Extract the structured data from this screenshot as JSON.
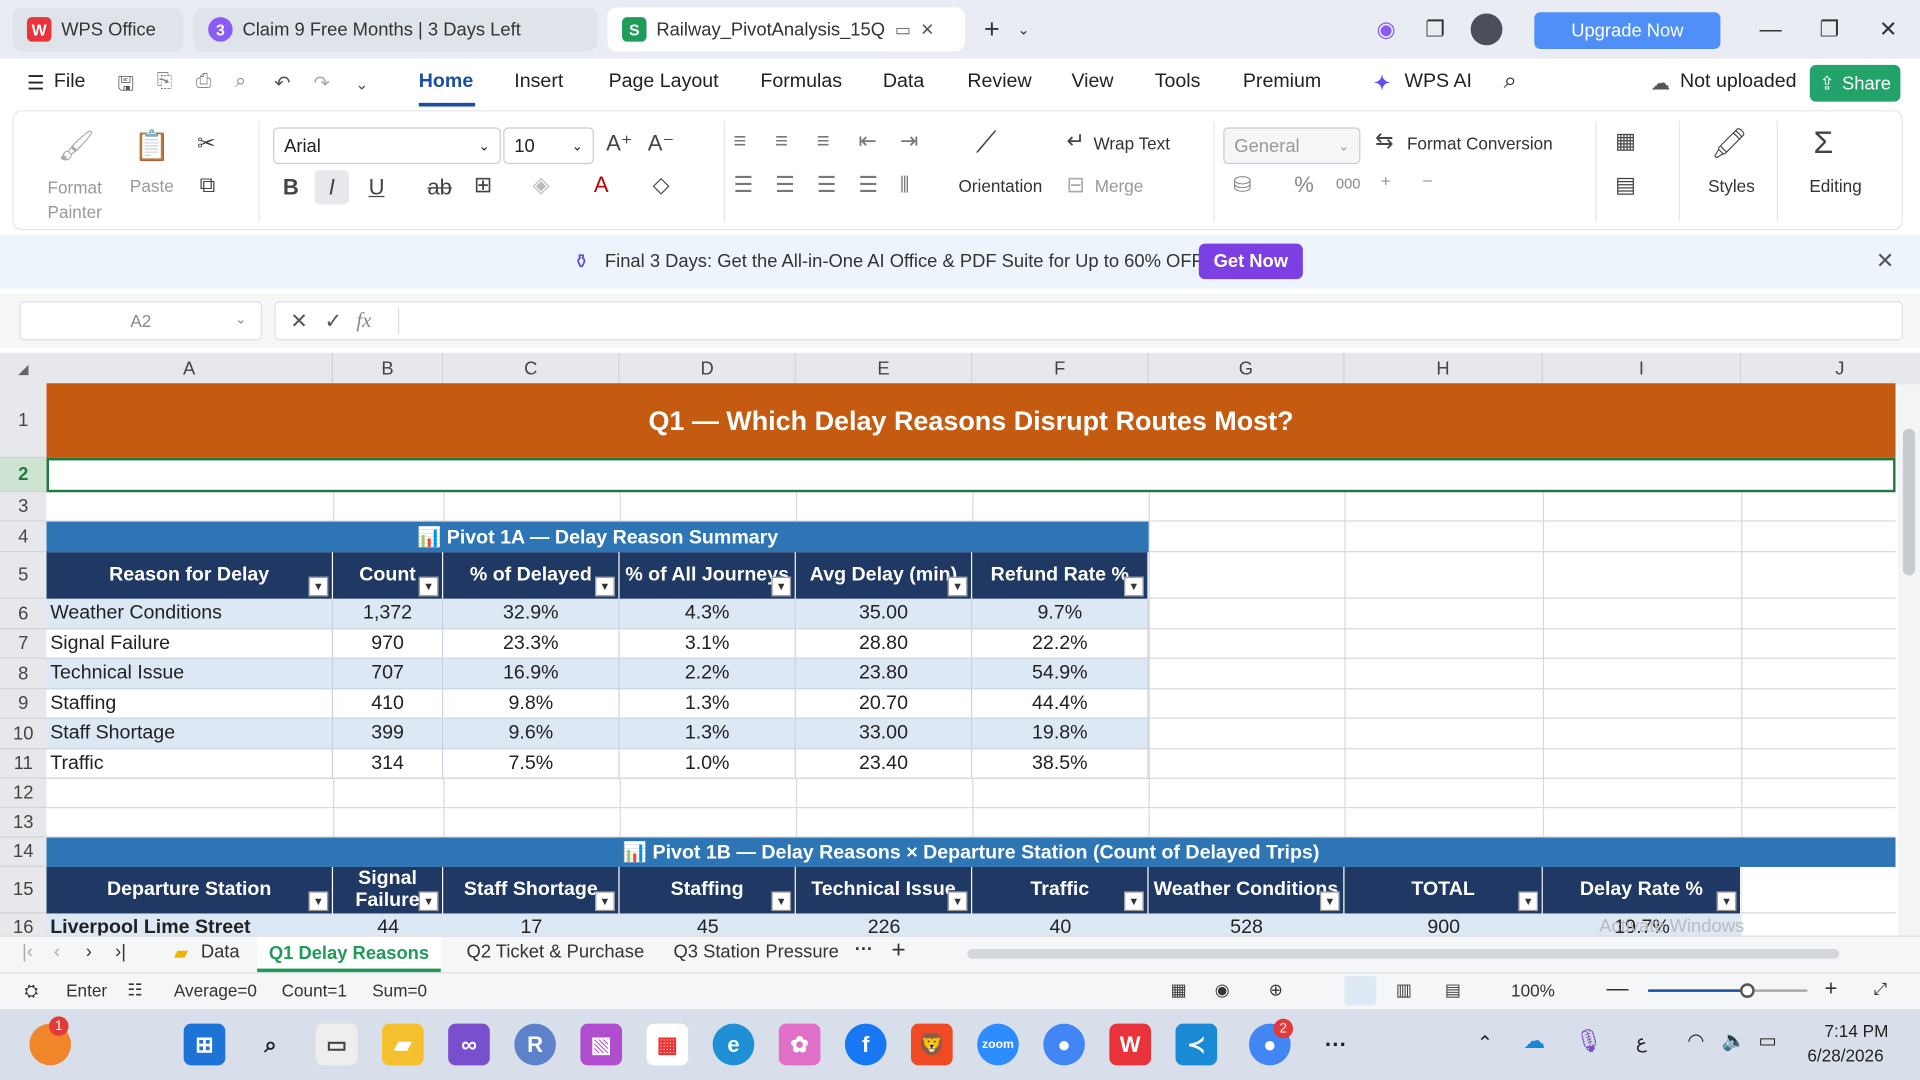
{
  "tabs": [
    {
      "label": "WPS Office",
      "icon": "wps-logo-icon"
    },
    {
      "label": "Claim 9 Free Months | 3 Days Left",
      "icon": "wps-promo-icon"
    },
    {
      "label": "Railway_PivotAnalysis_15Q",
      "icon": "spreadsheet-icon"
    }
  ],
  "title_bar": {
    "upgrade": "Upgrade Now"
  },
  "menu": {
    "file": "File",
    "items": [
      "Home",
      "Insert",
      "Page Layout",
      "Formulas",
      "Data",
      "Review",
      "View",
      "Tools",
      "Premium"
    ],
    "wps_ai": "WPS AI",
    "upload_status": "Not uploaded",
    "share": "Share"
  },
  "ribbon": {
    "format_painter": "Format Painter",
    "paste": "Paste",
    "font_name": "Arial",
    "font_size": "10",
    "orientation": "Orientation",
    "wrap_text": "Wrap Text",
    "merge": "Merge",
    "number_format": "General",
    "format_conversion": "Format Conversion",
    "styles": "Styles",
    "editing": "Editing",
    "num_decimals": "000"
  },
  "banner": {
    "text": "Final 3 Days: Get the All-in-One AI Office & PDF Suite for Up to 60% OFF!",
    "button": "Get Now"
  },
  "formula_bar": {
    "cell_ref": "A2",
    "fx": "fx",
    "content": ""
  },
  "sheet": {
    "columns": [
      "A",
      "B",
      "C",
      "D",
      "E",
      "F",
      "G",
      "H",
      "I",
      "J"
    ],
    "rows": [
      "1",
      "2",
      "3",
      "4",
      "5",
      "6",
      "7",
      "8",
      "9",
      "10",
      "11",
      "12",
      "13",
      "14",
      "15",
      "16"
    ],
    "title": "Q1 — Which Delay Reasons Disrupt Routes Most?",
    "pivot1a": {
      "title": "📊 Pivot 1A — Delay Reason Summary",
      "headers": [
        "Reason for Delay",
        "Count",
        "% of Delayed",
        "% of All Journeys",
        "Avg Delay (min)",
        "Refund Rate %"
      ],
      "rows": [
        [
          "Weather Conditions",
          "1,372",
          "32.9%",
          "4.3%",
          "35.00",
          "9.7%"
        ],
        [
          "Signal Failure",
          "970",
          "23.3%",
          "3.1%",
          "28.80",
          "22.2%"
        ],
        [
          "Technical Issue",
          "707",
          "16.9%",
          "2.2%",
          "23.80",
          "54.9%"
        ],
        [
          "Staffing",
          "410",
          "9.8%",
          "1.3%",
          "20.70",
          "44.4%"
        ],
        [
          "Staff Shortage",
          "399",
          "9.6%",
          "1.3%",
          "33.00",
          "19.8%"
        ],
        [
          "Traffic",
          "314",
          "7.5%",
          "1.0%",
          "23.40",
          "38.5%"
        ]
      ]
    },
    "pivot1b": {
      "title": "📊 Pivot 1B — Delay Reasons × Departure Station (Count of Delayed Trips)",
      "headers": [
        "Departure Station",
        "Signal Failure",
        "Staff Shortage",
        "Staffing",
        "Technical Issue",
        "Traffic",
        "Weather Conditions",
        "TOTAL",
        "Delay Rate %"
      ],
      "first_row": [
        "Liverpool Lime Street",
        "44",
        "17",
        "45",
        "226",
        "40",
        "528",
        "900",
        "19.7%"
      ]
    },
    "watermark": "Activate Windows"
  },
  "sheet_tabs": {
    "items": [
      "Data",
      "Q1 Delay Reasons",
      "Q2 Ticket & Purchase",
      "Q3 Station Pressure"
    ],
    "active": "Q1 Delay Reasons"
  },
  "status": {
    "mode": "Enter",
    "average": "Average=0",
    "count": "Count=1",
    "sum": "Sum=0",
    "zoom": "100%"
  },
  "taskbar": {
    "time": "7:14 PM",
    "date": "6/28/2026",
    "lang": "ع",
    "badge_left": "1",
    "badge_chrome": "2"
  },
  "colors": {
    "title_bg": "#c55a11",
    "pivot_title_bg": "#2e75b6",
    "header_bg": "#1f3864",
    "row_alt": "#dde8f5",
    "accent": "#1a4fa0",
    "upgrade": "#4f8ff7",
    "share": "#22a36a",
    "get_now": "#7b3fe4"
  }
}
